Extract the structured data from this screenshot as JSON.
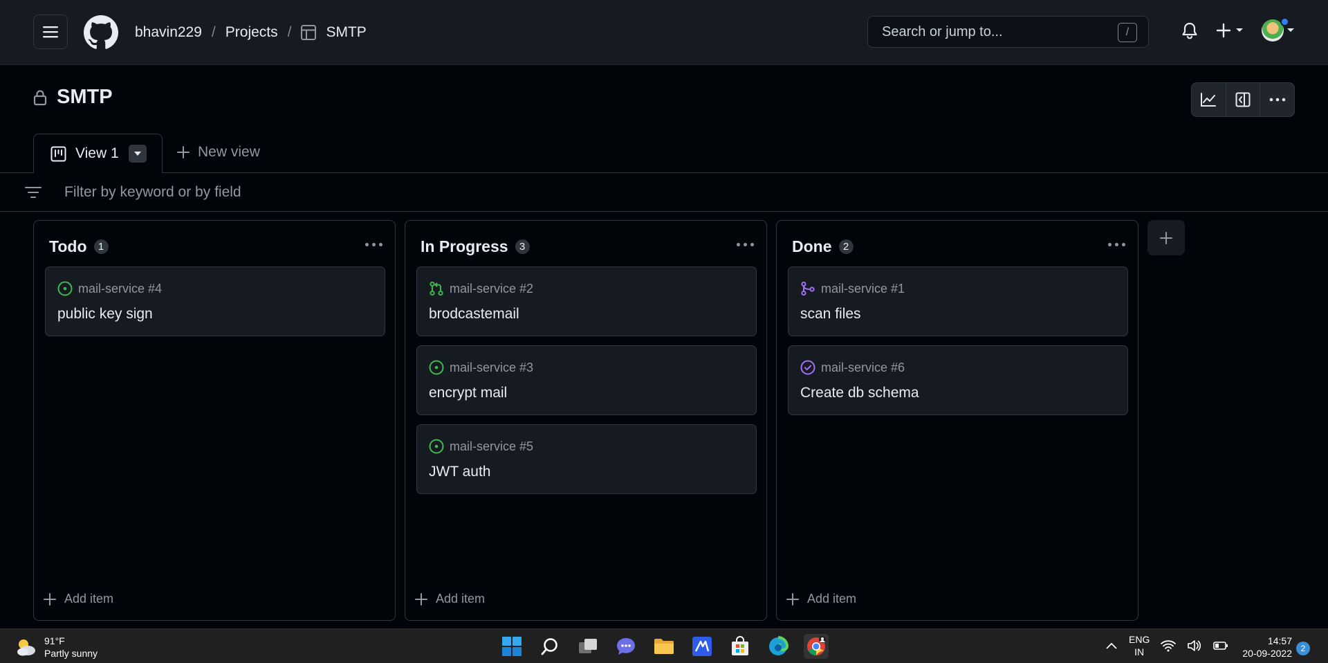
{
  "header": {
    "owner": "bhavin229",
    "separator": "/",
    "projects_link": "Projects",
    "project_name": "SMTP",
    "search_placeholder": "Search or jump to...",
    "search_shortcut": "/"
  },
  "project": {
    "title": "SMTP",
    "visibility": "private"
  },
  "views": {
    "active_tab": "View 1",
    "new_view_label": "New view"
  },
  "filter": {
    "placeholder": "Filter by keyword or by field"
  },
  "board": {
    "columns": [
      {
        "name": "Todo",
        "count": "1",
        "add_label": "Add item",
        "cards": [
          {
            "ref": "mail-service #4",
            "title": "public key sign",
            "status_icon": "issue-open-icon"
          }
        ]
      },
      {
        "name": "In Progress",
        "count": "3",
        "add_label": "Add item",
        "cards": [
          {
            "ref": "mail-service #2",
            "title": "brodcastemail",
            "status_icon": "pull-request-icon"
          },
          {
            "ref": "mail-service #3",
            "title": "encrypt mail",
            "status_icon": "issue-open-icon"
          },
          {
            "ref": "mail-service #5",
            "title": "JWT auth",
            "status_icon": "issue-open-icon"
          }
        ]
      },
      {
        "name": "Done",
        "count": "2",
        "add_label": "Add item",
        "cards": [
          {
            "ref": "mail-service #1",
            "title": "scan files",
            "status_icon": "pull-request-merged-icon"
          },
          {
            "ref": "mail-service #6",
            "title": "Create db schema",
            "status_icon": "issue-closed-icon"
          }
        ]
      }
    ]
  },
  "taskbar": {
    "weather_temp": "91°F",
    "weather_desc": "Partly sunny",
    "lang_line1": "ENG",
    "lang_line2": "IN",
    "time": "14:57",
    "date": "20-09-2022",
    "notifications": "2"
  },
  "colors": {
    "open": "#3fb950",
    "merged": "#a371f7"
  }
}
